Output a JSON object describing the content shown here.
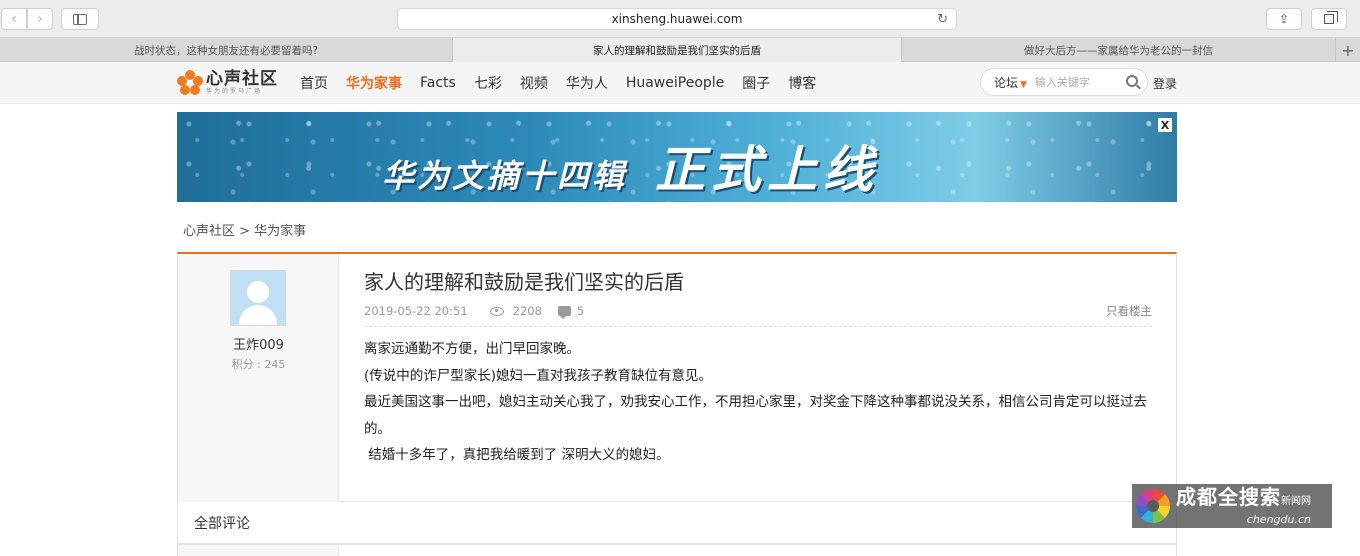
{
  "browser": {
    "url": "xinsheng.huawei.com",
    "back_glyph": "‹",
    "forward_glyph": "›",
    "reload_glyph": "↻",
    "share_glyph": "⇪",
    "new_tab_glyph": "+",
    "tabs": [
      {
        "label": "战时状态，这种女朋友还有必要留着吗?",
        "active": false
      },
      {
        "label": "家人的理解和鼓励是我们坚实的后盾",
        "active": true
      },
      {
        "label": "做好大后方——家属给华为老公的一封信",
        "active": false
      }
    ]
  },
  "site": {
    "logo_main": "心声社区",
    "logo_sub": "华为的罗马广场",
    "nav": [
      {
        "label": "首页",
        "active": false
      },
      {
        "label": "华为家事",
        "active": true
      },
      {
        "label": "Facts",
        "active": false
      },
      {
        "label": "七彩",
        "active": false
      },
      {
        "label": "视频",
        "active": false
      },
      {
        "label": "华为人",
        "active": false
      },
      {
        "label": "HuaweiPeople",
        "active": false
      },
      {
        "label": "圈子",
        "active": false
      },
      {
        "label": "博客",
        "active": false
      }
    ],
    "search_scope": "论坛",
    "search_placeholder": "输入关键字",
    "login": "登录",
    "accent_color": "#f06d1f"
  },
  "banner": {
    "text_a": "华为文摘十四辑",
    "text_b": "正式上线",
    "close": "X"
  },
  "breadcrumb": "心声社区 > 华为家事",
  "post": {
    "author": "王炸009",
    "score": "积分 : 245",
    "title": "家人的理解和鼓励是我们坚实的后盾",
    "date": "2019-05-22 20:51",
    "views": "2208",
    "comments": "5",
    "only_op": "只看楼主",
    "paragraphs": [
      "离家远通勤不方便，出门早回家晚。",
      "(传说中的诈尸型家长)媳妇一直对我孩子教育缺位有意见。",
      "最近美国这事一出吧，媳妇主动关心我了，劝我安心工作，不用担心家里，对奖金下降这种事都说没关系，相信公司肯定可以挺过去的。",
      " 结婚十多年了，真把我给暖到了 深明大义的媳妇。"
    ]
  },
  "comments_header": "全部评论",
  "watermark": {
    "main": "成都全搜索",
    "main_small": "新闻网",
    "sub": "chengdu.cn"
  }
}
